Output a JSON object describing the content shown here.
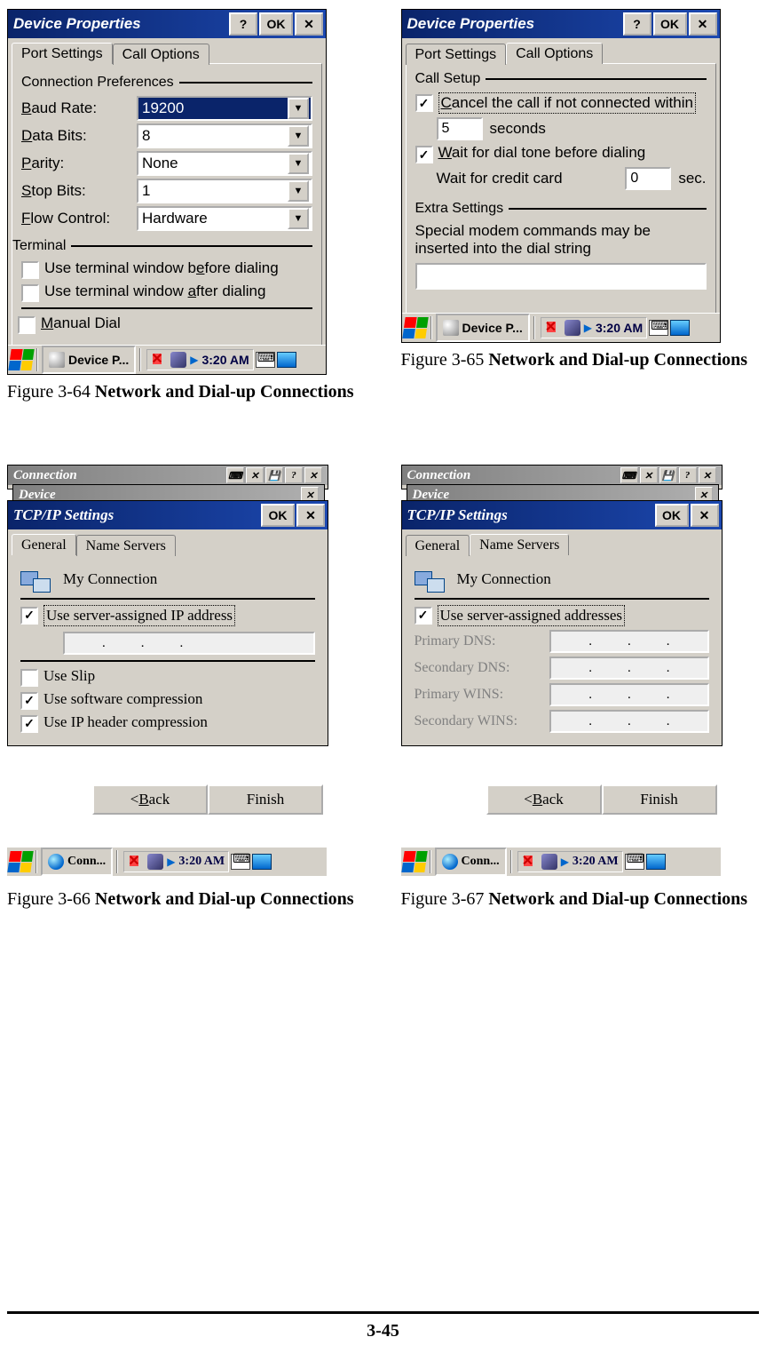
{
  "captions": {
    "f64": {
      "no": "Figure 3-64",
      "title": "Network and Dial-up Connections"
    },
    "f65": {
      "no": "Figure 3-65",
      "title": "Network and Dial-up Connections"
    },
    "f66": {
      "no": "Figure 3-66",
      "title": "Network and Dial-up Connections"
    },
    "f67": {
      "no": "Figure 3-67",
      "title": "Network and Dial-up Connections"
    }
  },
  "page_number": "3-45",
  "taskbar": {
    "time": "3:20 AM",
    "task_device": "Device P...",
    "task_conn": "Conn..."
  },
  "win64": {
    "title": "Device Properties",
    "ok": "OK",
    "tabs": {
      "port": "Port Settings",
      "call": "Call Options"
    },
    "group_conn": "Connection Preferences",
    "baud_lbl": "Baud Rate:",
    "baud_val": "19200",
    "databits_lbl": "Data Bits:",
    "databits_val": "8",
    "parity_lbl": "Parity:",
    "parity_val": "None",
    "stopbits_lbl": "Stop Bits:",
    "stopbits_val": "1",
    "flow_lbl": "Flow Control:",
    "flow_val": "Hardware",
    "group_term": "Terminal",
    "cb_before": "Use terminal window before dialing",
    "cb_after": "Use terminal window after dialing",
    "cb_manual": "Manual Dial"
  },
  "win65": {
    "title": "Device Properties",
    "ok": "OK",
    "tabs": {
      "port": "Port Settings",
      "call": "Call Options"
    },
    "group_setup": "Call Setup",
    "cb_cancel": "Cancel the call if not connected within",
    "seconds_val": "5",
    "seconds_lbl": "seconds",
    "cb_wait_tone": "Wait for dial tone before dialing",
    "credit_lbl": "Wait for credit card",
    "credit_val": "0",
    "credit_unit": "sec.",
    "group_extra": "Extra Settings",
    "extra_note": "Special modem commands may be inserted into the dial string"
  },
  "win66": {
    "bg1": "Connection",
    "bg2": "Device",
    "title": "TCP/IP Settings",
    "ok": "OK",
    "tabs": {
      "gen": "General",
      "ns": "Name Servers"
    },
    "conn_name": "My Connection",
    "cb_srv_ip": "Use server-assigned IP address",
    "cb_slip": "Use Slip",
    "cb_swcomp": "Use software compression",
    "cb_iphdr": "Use IP header compression",
    "btn_back": "< Back",
    "btn_finish": "Finish"
  },
  "win67": {
    "bg1": "Connection",
    "bg2": "Device",
    "title": "TCP/IP Settings",
    "ok": "OK",
    "tabs": {
      "gen": "General",
      "ns": "Name Servers"
    },
    "conn_name": "My Connection",
    "cb_srv_addr": "Use server-assigned addresses",
    "pdns": "Primary DNS:",
    "sdns": "Secondary DNS:",
    "pwins": "Primary WINS:",
    "swins": "Secondary WINS:",
    "btn_back": "< Back",
    "btn_finish": "Finish"
  }
}
